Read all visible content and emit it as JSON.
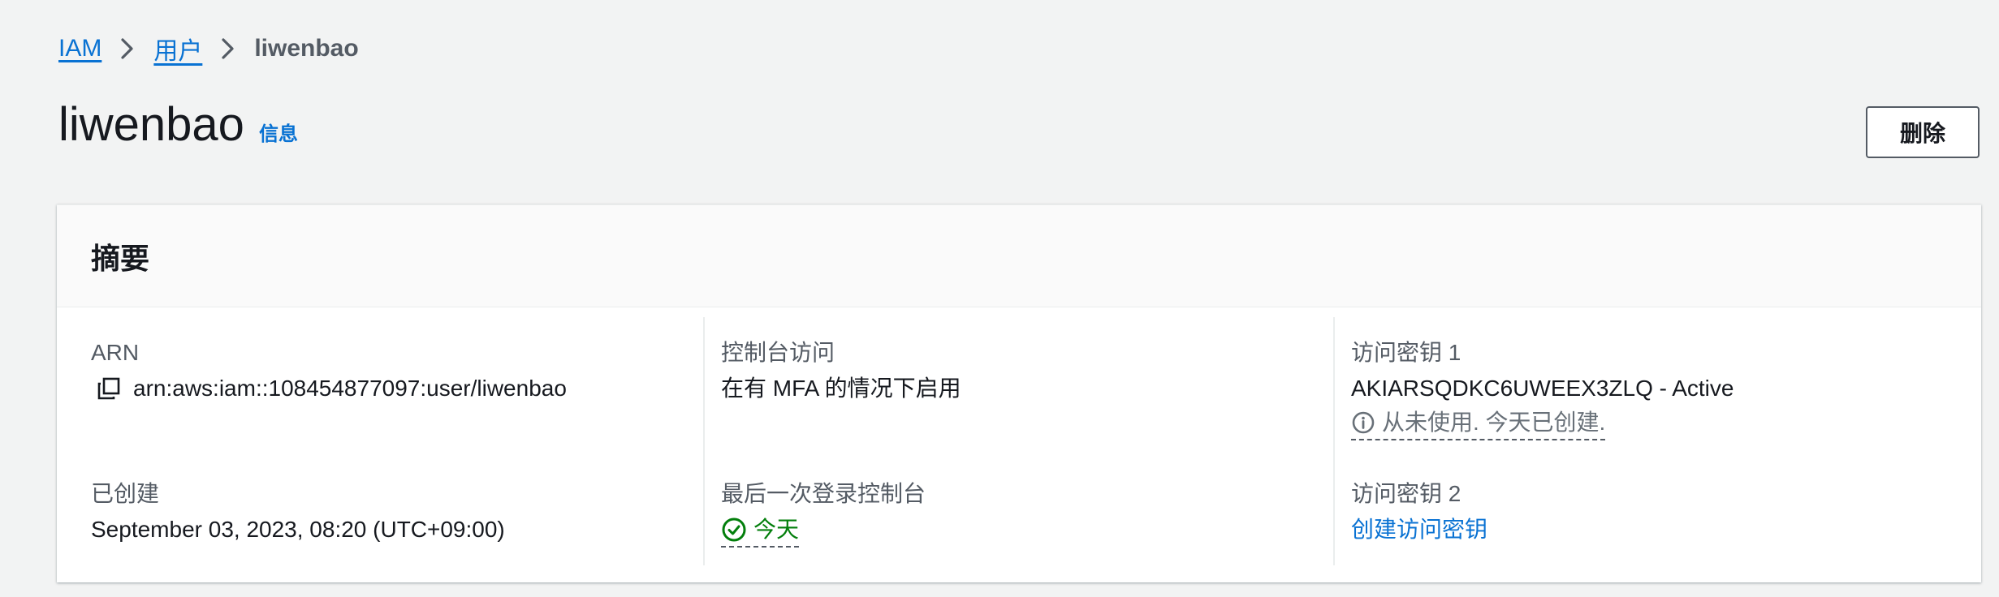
{
  "breadcrumb": {
    "items": [
      {
        "label": "IAM"
      },
      {
        "label": "用户"
      }
    ],
    "current": "liwenbao"
  },
  "header": {
    "title": "liwenbao",
    "info_label": "信息",
    "delete_label": "删除"
  },
  "summary": {
    "title": "摘要",
    "arn": {
      "label": "ARN",
      "value": "arn:aws:iam::108454877097:user/liwenbao"
    },
    "created": {
      "label": "已创建",
      "value": "September 03, 2023, 08:20 (UTC+09:00)"
    },
    "console_access": {
      "label": "控制台访问",
      "value": "在有 MFA 的情况下启用"
    },
    "last_console_signin": {
      "label": "最后一次登录控制台",
      "value": "今天"
    },
    "access_key_1": {
      "label": "访问密钥 1",
      "value": "AKIARSQDKC6UWEEX3ZLQ - Active",
      "status": "从未使用. 今天已创建."
    },
    "access_key_2": {
      "label": "访问密钥 2",
      "link": "创建访问密钥"
    }
  },
  "colors": {
    "link": "#0972d3",
    "success": "#037f0c",
    "muted": "#545b64",
    "background": "#f2f3f3"
  }
}
